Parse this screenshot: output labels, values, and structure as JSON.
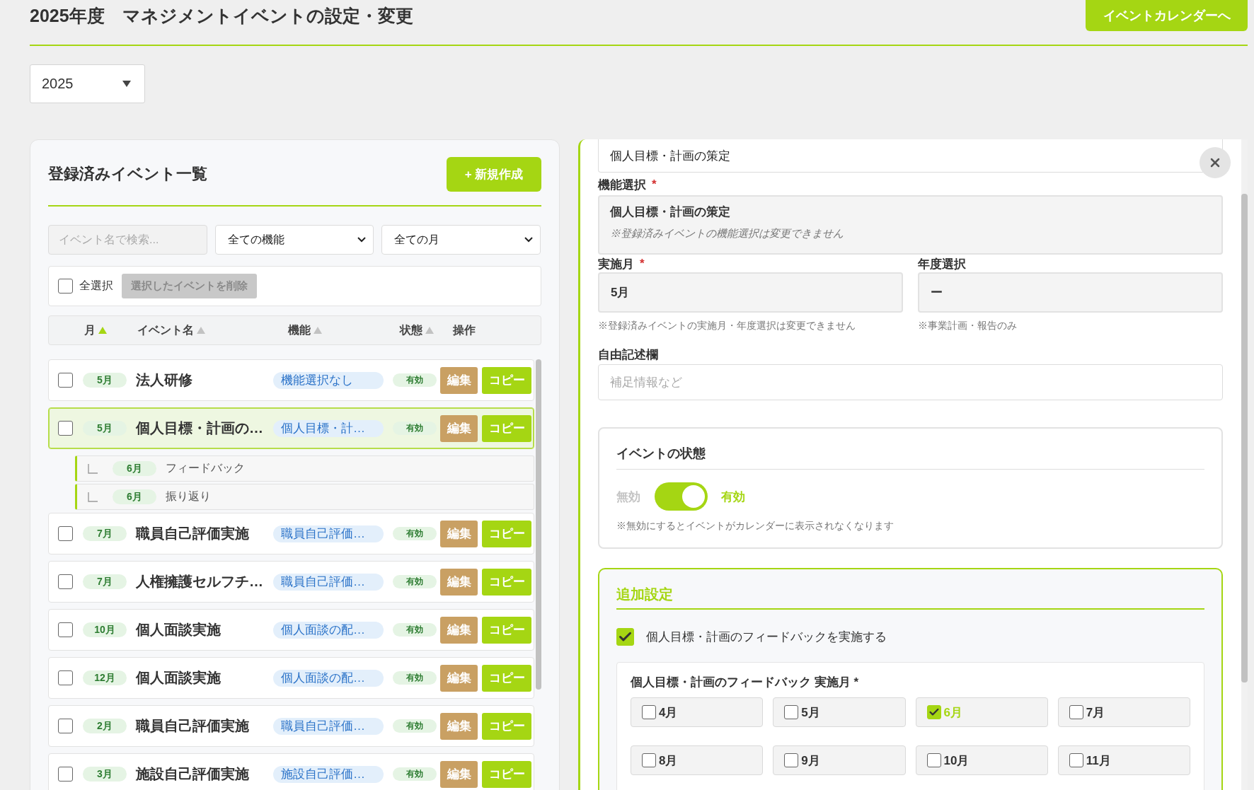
{
  "page": {
    "title": "2025年度　マネジメントイベントの設定・変更",
    "calendar_button": "イベントカレンダーへ"
  },
  "year_select": {
    "value": "2025"
  },
  "event_list": {
    "title": "登録済みイベント一覧",
    "new_button": "+ 新規作成",
    "search": {
      "placeholder": "イベント名で検索..."
    },
    "filters": [
      {
        "value": "全ての機能"
      },
      {
        "value": "全ての月"
      }
    ],
    "select_all": {
      "label": "全選択",
      "checked": false
    },
    "delete_button": {
      "label": "選択したイベントを削除",
      "disabled": true
    },
    "columns": [
      {
        "label": "月",
        "active": true
      },
      {
        "label": "イベント名",
        "active": false
      },
      {
        "label": "機能",
        "active": false
      },
      {
        "label": "状態",
        "active": false
      },
      {
        "label": "操作"
      }
    ],
    "rows": [
      {
        "checked": false,
        "selected": false,
        "month": "5月",
        "name": "法人研修",
        "function": "機能選択なし",
        "status": "有効",
        "actions": [
          {
            "kind": "edit",
            "label": "編集"
          },
          {
            "kind": "copy",
            "label": "コピー"
          }
        ]
      },
      {
        "checked": false,
        "selected": true,
        "month": "5月",
        "name": "個人目標・計画の…",
        "function": "個人目標・計…",
        "status": "有効",
        "actions": [
          {
            "kind": "edit",
            "label": "編集"
          },
          {
            "kind": "copy",
            "label": "コピー"
          }
        ],
        "children": [
          {
            "month": "6月",
            "name": "フィードバック"
          },
          {
            "month": "6月",
            "name": "振り返り"
          }
        ]
      },
      {
        "checked": false,
        "selected": false,
        "month": "7月",
        "name": "職員自己評価実施",
        "function": "職員自己評価…",
        "status": "有効",
        "actions": [
          {
            "kind": "edit",
            "label": "編集"
          },
          {
            "kind": "copy",
            "label": "コピー"
          }
        ]
      },
      {
        "checked": false,
        "selected": false,
        "month": "7月",
        "name": "人権擁護セルフチ…",
        "function": "職員自己評価…",
        "status": "有効",
        "actions": [
          {
            "kind": "edit",
            "label": "編集"
          },
          {
            "kind": "copy",
            "label": "コピー"
          }
        ]
      },
      {
        "checked": false,
        "selected": false,
        "month": "10月",
        "name": "個人面談実施",
        "function": "個人面談の配…",
        "status": "有効",
        "actions": [
          {
            "kind": "edit",
            "label": "編集"
          },
          {
            "kind": "copy",
            "label": "コピー"
          }
        ]
      },
      {
        "checked": false,
        "selected": false,
        "month": "12月",
        "name": "個人面談実施",
        "function": "個人面談の配…",
        "status": "有効",
        "actions": [
          {
            "kind": "edit",
            "label": "編集"
          },
          {
            "kind": "copy",
            "label": "コピー"
          }
        ]
      },
      {
        "checked": false,
        "selected": false,
        "month": "2月",
        "name": "職員自己評価実施",
        "function": "職員自己評価…",
        "status": "有効",
        "actions": [
          {
            "kind": "edit",
            "label": "編集"
          },
          {
            "kind": "copy",
            "label": "コピー"
          }
        ]
      },
      {
        "checked": false,
        "selected": false,
        "month": "3月",
        "name": "施設自己評価実施",
        "function": "施設自己評価…",
        "status": "有効",
        "actions": [
          {
            "kind": "edit",
            "label": "編集"
          },
          {
            "kind": "copy",
            "label": "コピー"
          }
        ]
      }
    ]
  },
  "form": {
    "event_name": {
      "value": "個人目標・計画の策定"
    },
    "function": {
      "label": "機能選択",
      "required_mark": "*",
      "value": "個人目標・計画の策定",
      "note": "※登録済みイベントの機能選択は変更できません"
    },
    "month": {
      "label": "実施月",
      "required_mark": "*",
      "value": "5月",
      "note": "※登録済みイベントの実施月・年度選択は変更できません"
    },
    "fiscal_year": {
      "label": "年度選択",
      "value": "ー",
      "note": "※事業計画・報告のみ"
    },
    "memo": {
      "label": "自由記述欄",
      "placeholder": "補足情報など"
    },
    "status": {
      "title": "イベントの状態",
      "off_label": "無効",
      "on_label": "有効",
      "on": true,
      "note": "※無効にするとイベントがカレンダーに表示されなくなります"
    },
    "additional": {
      "title": "追加設定",
      "feedback": {
        "label": "個人目標・計画のフィードバックを実施する",
        "checked": true
      },
      "months_title": "個人目標・計画のフィードバック 実施月 *",
      "months": [
        {
          "label": "4月",
          "checked": false
        },
        {
          "label": "5月",
          "checked": false
        },
        {
          "label": "6月",
          "checked": true
        },
        {
          "label": "7月",
          "checked": false
        },
        {
          "label": "8月",
          "checked": false
        },
        {
          "label": "9月",
          "checked": false
        },
        {
          "label": "10月",
          "checked": false
        },
        {
          "label": "11月",
          "checked": false
        }
      ]
    }
  }
}
